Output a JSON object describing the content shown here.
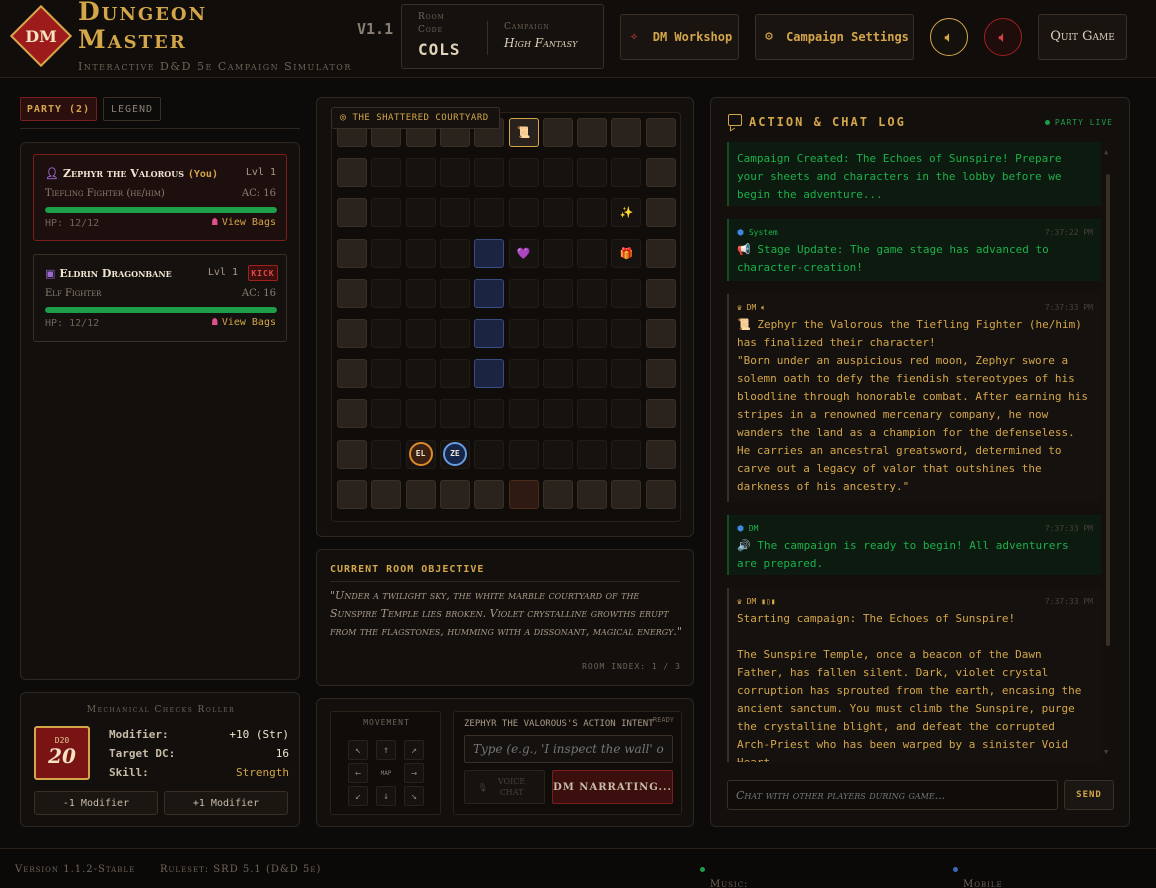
{
  "header": {
    "logo_text": "DM",
    "title_line1": "Dungeon",
    "title_line2": "Master",
    "subtitle": "Interactive D&D 5e Campaign Simulator",
    "version": "V1.1",
    "room_code_label": "Room Code",
    "room_code": "COLS",
    "campaign_label": "Campaign",
    "campaign": "High Fantasy",
    "dm_workshop": "DM Workshop",
    "campaign_settings": "Campaign Settings",
    "quit": "Quit Game"
  },
  "party": {
    "tab_party": "PARTY (2)",
    "tab_legend": "LEGEND",
    "members": [
      {
        "name": "Zephyr the Valorous",
        "you": "(You)",
        "level": "Lvl 1",
        "class": "Tiefling Fighter (he/him)",
        "ac": "AC: 16",
        "hp": "HP: 12/12",
        "hp_fraction": 1.0,
        "bags": "View Bags"
      },
      {
        "name": "Eldrin Dragonbane",
        "level": "Lvl 1",
        "kick": "KICK",
        "class": "Elf Fighter",
        "ac": "AC: 16",
        "hp": "HP: 12/12",
        "hp_fraction": 1.0,
        "bags": "View Bags"
      }
    ]
  },
  "dice": {
    "title": "Mechanical Checks Roller",
    "die_label": "D20",
    "die_value": "20",
    "modifier_label": "Modifier:",
    "modifier_value": "+10 (Str)",
    "dc_label": "Target DC:",
    "dc_value": "16",
    "skill_label": "Skill:",
    "skill_value": "Strength",
    "minus_btn": "-1 Modifier",
    "plus_btn": "+1 Modifier"
  },
  "map": {
    "location": "THE SHATTERED COURTYARD",
    "tokens": [
      {
        "label": "EL",
        "color": "#e08a2a"
      },
      {
        "label": "ZE",
        "color": "#6a9ae0"
      }
    ]
  },
  "objective": {
    "title": "CURRENT ROOM OBJECTIVE",
    "text": "\"Under a twilight sky, the white marble courtyard of the Sunspire Temple lies broken. Violet crystalline growths erupt from the flagstones, humming with a dissonant, magical energy.\"",
    "room_index": "ROOM INDEX: 1 / 3"
  },
  "action": {
    "movement_label": "MOVEMENT",
    "map_label": "MAP",
    "intent_label": "ZEPHYR THE VALOROUS'S ACTION INTENT",
    "ready_label": "READY",
    "intent_placeholder": "Type (e.g., 'I inspect the wall' or",
    "voice_label": "VOICE CHAT",
    "narrate_label": "DM NARRATING..."
  },
  "chat": {
    "title": "ACTION & CHAT LOG",
    "status": "PARTY LIVE",
    "messages": [
      {
        "text": "Campaign Created: The Echoes of Sunspire! Prepare your sheets and characters in the lobby before we begin the adventure..."
      },
      {
        "sender": "System",
        "time": "7:37:22 PM",
        "text": "📢 Stage Update: The game stage has advanced to character-creation!"
      },
      {
        "sender": "DM",
        "time": "7:37:33 PM",
        "text": "📜 Zephyr the Valorous the Tiefling Fighter (he/him) has finalized their character!",
        "story": "\"Born under an auspicious red moon, Zephyr swore a solemn oath to defy the fiendish stereotypes of his bloodline through honorable combat. After earning his stripes in a renowned mercenary company, he now wanders the land as a champion for the defenseless. He carries an ancestral greatsword, determined to carve out a legacy of valor that outshines the darkness of his ancestry.\""
      },
      {
        "sender": "DM",
        "time": "7:37:33 PM",
        "text": "🔊 The campaign is ready to begin! All adventurers are prepared."
      },
      {
        "sender": "DM",
        "time": "7:37:33 PM",
        "text": "Starting campaign: The Echoes of Sunspire!",
        "story": "The Sunspire Temple, once a beacon of the Dawn Father, has fallen silent. Dark, violet crystal corruption has sprouted from the earth, encasing the ancient sanctum. You must climb the Sunspire, purge the crystalline blight, and defeat the corrupted Arch-Priest who has been warped by a sinister Void Heart."
      }
    ],
    "input_placeholder": "Chat with other players during game...",
    "send": "SEND"
  },
  "footer": {
    "version": "Version 1.1.2-Stable",
    "ruleset": "Ruleset: SRD 5.1 (D&D 5e)",
    "music": "Music: Procedural Ambient Synths",
    "mobile": "Mobile Controller Active"
  },
  "colors": {
    "accent_gold": "#d4a64a",
    "danger_red": "#a0201f",
    "hp_green": "#1d9e48",
    "chat_green": "#1db04a"
  }
}
